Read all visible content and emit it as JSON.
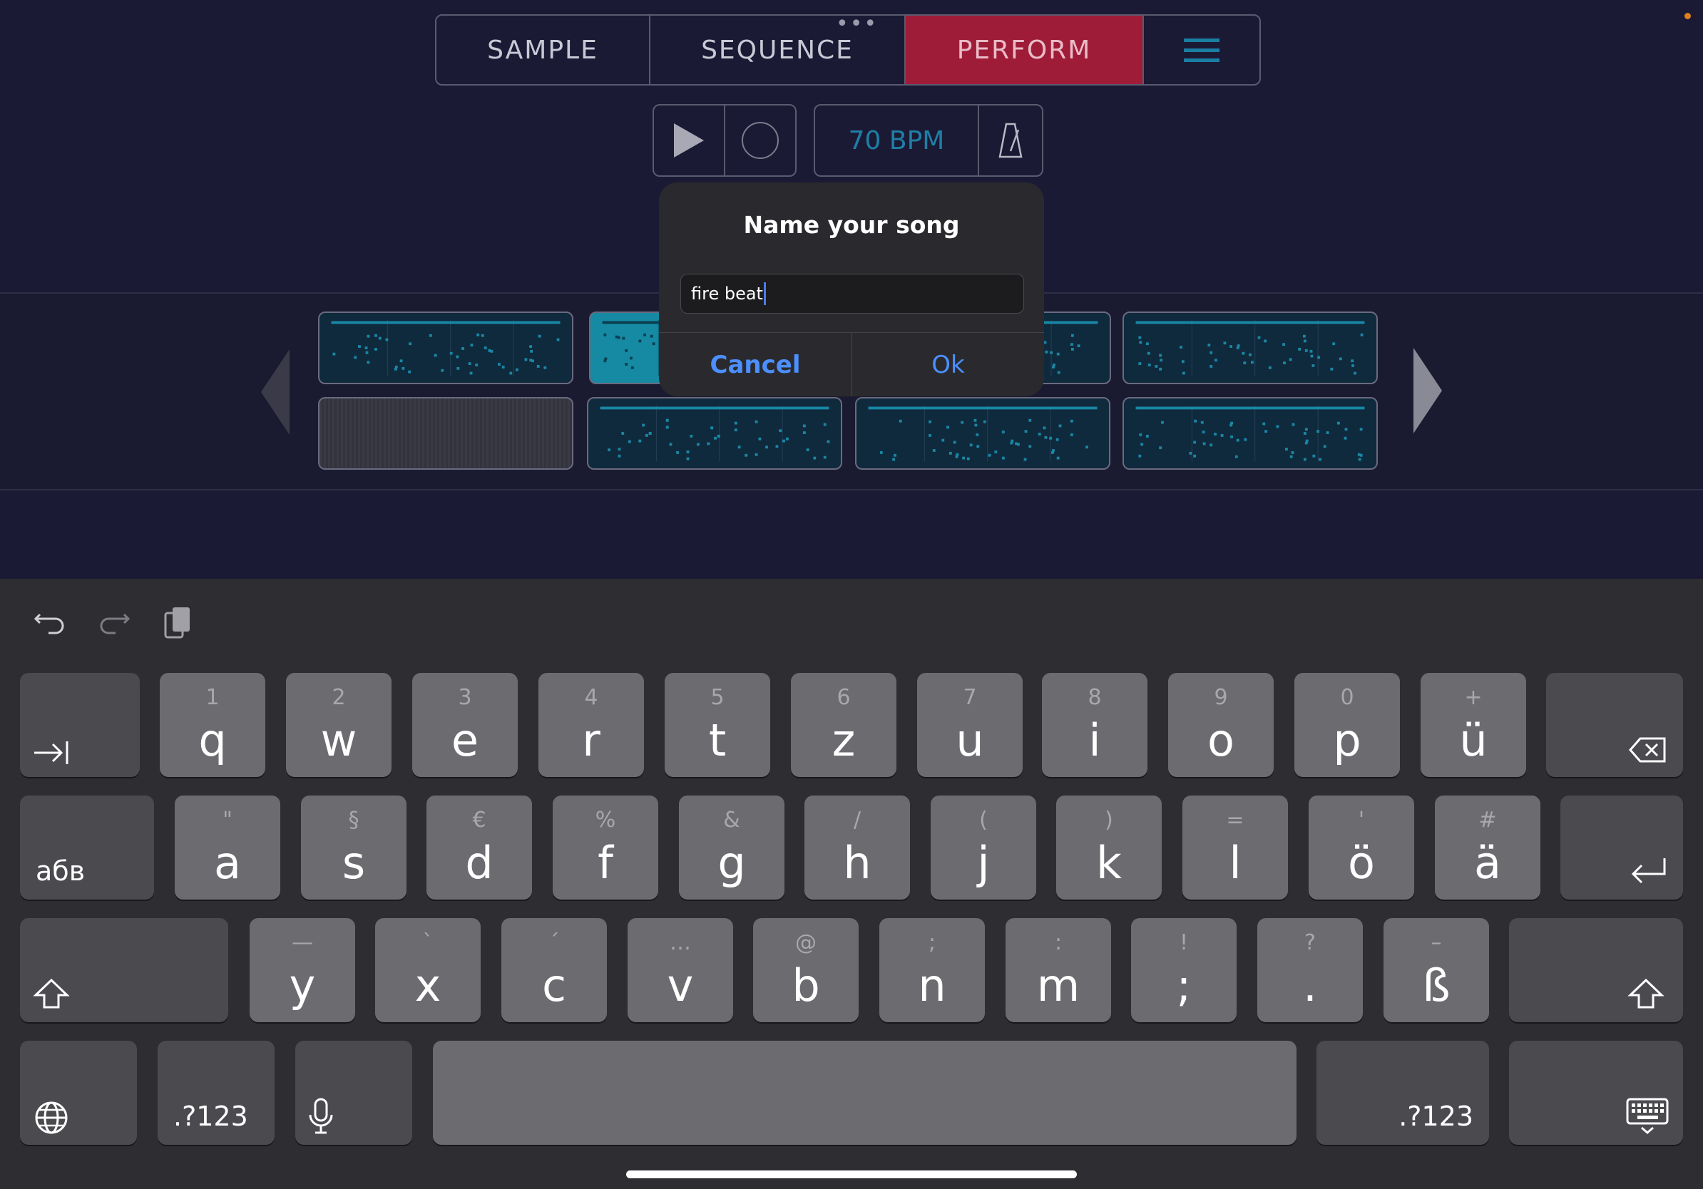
{
  "tabs": {
    "sample": "SAMPLE",
    "sequence": "SEQUENCE",
    "perform": "PERFORM"
  },
  "transport": {
    "bpm": "70 BPM"
  },
  "dialog": {
    "title": "Name your song",
    "input_value": "fire beat",
    "cancel": "Cancel",
    "ok": "Ok"
  },
  "keyboard": {
    "row1": [
      {
        "main": "q",
        "sub": "1"
      },
      {
        "main": "w",
        "sub": "2"
      },
      {
        "main": "e",
        "sub": "3"
      },
      {
        "main": "r",
        "sub": "4"
      },
      {
        "main": "t",
        "sub": "5"
      },
      {
        "main": "z",
        "sub": "6"
      },
      {
        "main": "u",
        "sub": "7"
      },
      {
        "main": "i",
        "sub": "8"
      },
      {
        "main": "o",
        "sub": "9"
      },
      {
        "main": "p",
        "sub": "0"
      },
      {
        "main": "ü",
        "sub": "+"
      }
    ],
    "row2": [
      {
        "main": "a",
        "sub": "\""
      },
      {
        "main": "s",
        "sub": "§"
      },
      {
        "main": "d",
        "sub": "€"
      },
      {
        "main": "f",
        "sub": "%"
      },
      {
        "main": "g",
        "sub": "&"
      },
      {
        "main": "h",
        "sub": "/"
      },
      {
        "main": "j",
        "sub": "("
      },
      {
        "main": "k",
        "sub": ")"
      },
      {
        "main": "l",
        "sub": "="
      },
      {
        "main": "ö",
        "sub": "'"
      },
      {
        "main": "ä",
        "sub": "#"
      }
    ],
    "row3": [
      {
        "main": "y",
        "sub": "—"
      },
      {
        "main": "x",
        "sub": "`"
      },
      {
        "main": "c",
        "sub": "´"
      },
      {
        "main": "v",
        "sub": "…"
      },
      {
        "main": "b",
        "sub": "@"
      },
      {
        "main": "n",
        "sub": ";"
      },
      {
        "main": "m",
        "sub": ":"
      },
      {
        "main": ";",
        "sub": "!"
      },
      {
        "main": ".",
        "sub": "?"
      },
      {
        "main": "ß",
        "sub": "–"
      }
    ],
    "lang_key": "абв",
    "numbers_key": ".?123",
    "icons": [
      "undo-icon",
      "redo-icon",
      "paste-icon",
      "tab-icon",
      "delete-icon",
      "return-icon",
      "shift-icon",
      "globe-icon",
      "microphone-icon",
      "keyboard-dismiss-icon"
    ]
  },
  "colors": {
    "perform_active": "#9f1c38",
    "accent": "#1f7fa6",
    "dialog_button": "#4c8fff"
  }
}
